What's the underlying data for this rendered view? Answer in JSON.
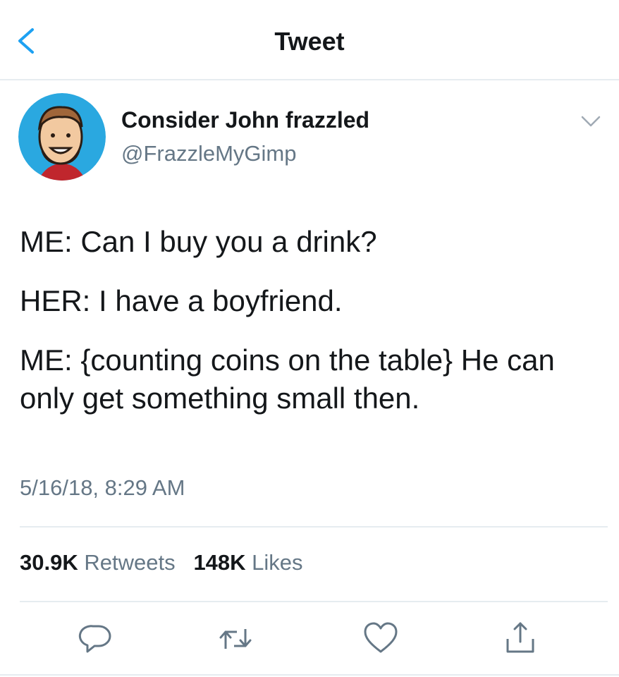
{
  "header": {
    "title": "Tweet"
  },
  "author": {
    "name": "Consider John frazzled",
    "handle": "@FrazzleMyGimp"
  },
  "tweet": {
    "lines": [
      "ME: Can I buy you a drink?",
      "HER: I have a boyfriend.",
      "ME: {counting coins on the table} He can only get something small then."
    ],
    "timestamp": "5/16/18, 8:29 AM"
  },
  "stats": {
    "retweets_count": "30.9K",
    "retweets_label": "Retweets",
    "likes_count": "148K",
    "likes_label": "Likes"
  },
  "colors": {
    "accent": "#1da1f2",
    "secondary_text": "#657786",
    "divider": "#e6ecf0"
  },
  "icons": [
    "back-chevron-icon",
    "chevron-down-icon",
    "reply-icon",
    "retweet-icon",
    "like-icon",
    "share-icon"
  ]
}
